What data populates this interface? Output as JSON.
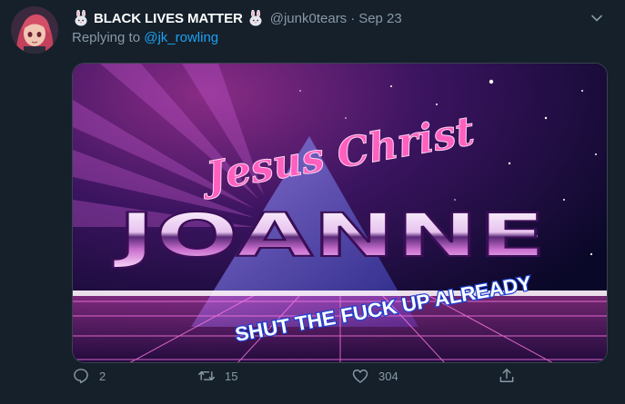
{
  "tweet": {
    "display_name": "BLACK LIVES MATTER",
    "handle": "@junk0tears",
    "separator": "·",
    "date": "Sep 23",
    "reply_prefix": "Replying to ",
    "reply_mention": "@jk_rowling",
    "emoji_icons": [
      "rabbit-face-icon",
      "rabbit-face-icon"
    ]
  },
  "media": {
    "line1": "Jesus Christ",
    "line2": "JOANNE",
    "line3": "SHUT THE FUCK UP ALREADY"
  },
  "actions": {
    "reply_count": "2",
    "retweet_count": "15",
    "like_count": "304"
  },
  "colors": {
    "background": "#15202b",
    "secondary_text": "#8899a6",
    "link": "#1da1f2",
    "border": "#38444d"
  }
}
